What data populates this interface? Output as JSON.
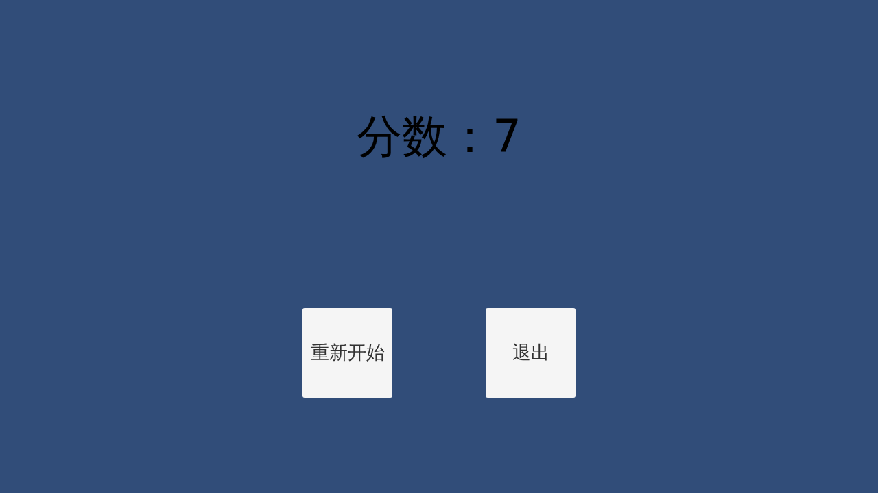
{
  "score": {
    "text": "分数：7"
  },
  "buttons": [
    {
      "label": "重新开始"
    },
    {
      "label": "退出"
    }
  ]
}
